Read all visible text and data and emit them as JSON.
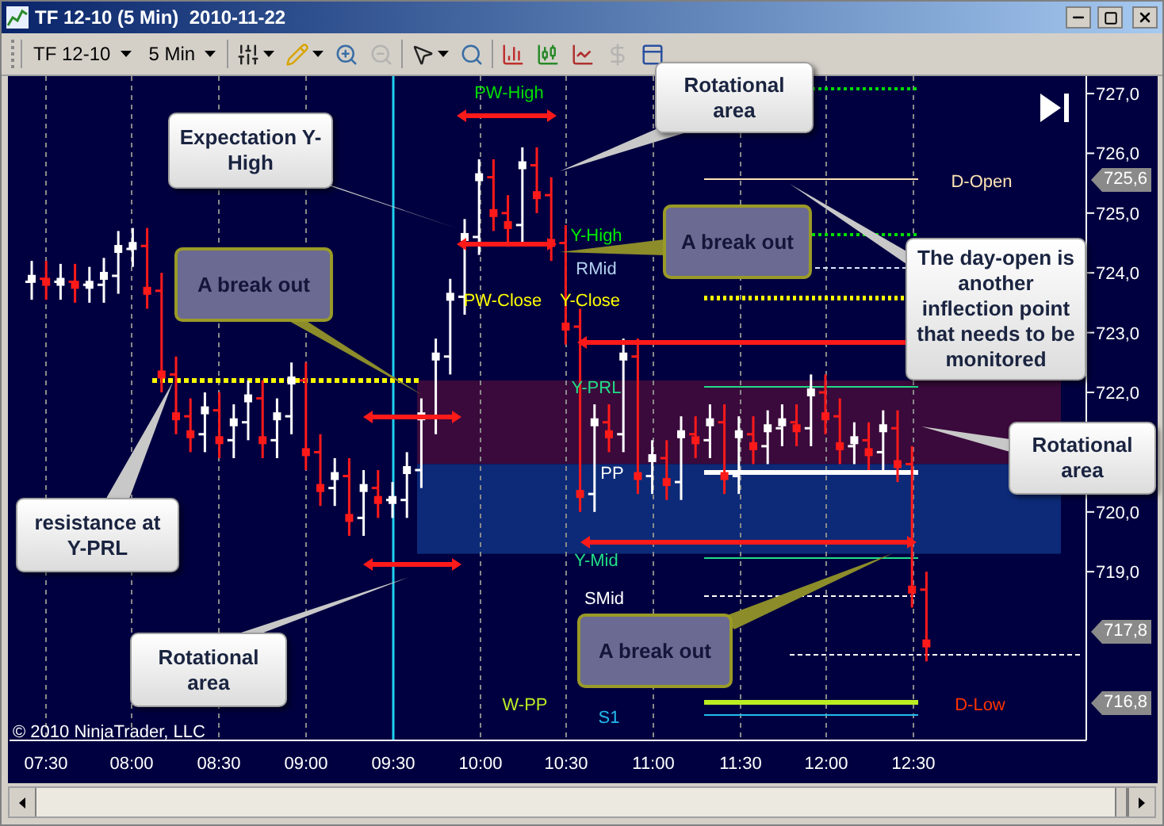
{
  "window": {
    "title": "TF 12-10 (5 Min)  2010-11-22"
  },
  "toolbar": {
    "instrument": "TF 12-10",
    "interval": "5 Min",
    "tools": [
      {
        "kind": "bar-style",
        "disabled": false
      },
      {
        "kind": "draw",
        "disabled": false
      },
      {
        "kind": "zoom-in",
        "disabled": false
      },
      {
        "kind": "zoom-out",
        "disabled": true
      },
      {
        "kind": "select",
        "disabled": false
      },
      {
        "kind": "zoom-box",
        "disabled": false
      },
      {
        "kind": "indicators",
        "disabled": false
      },
      {
        "kind": "chart-style",
        "disabled": false
      },
      {
        "kind": "data-box",
        "disabled": false
      },
      {
        "kind": "currency",
        "disabled": true
      },
      {
        "kind": "properties",
        "disabled": false
      }
    ]
  },
  "chart": {
    "price_axis": [
      "727,0",
      "726,0",
      "725,0",
      "724,0",
      "723,0",
      "722,0",
      "720,0",
      "719,0"
    ],
    "price_tags": [
      "725,6",
      "717,8",
      "716,8"
    ],
    "time_axis": [
      "07:30",
      "08:00",
      "08:30",
      "09:00",
      "09:30",
      "10:00",
      "10:30",
      "11:00",
      "11:30",
      "12:00",
      "12:30"
    ],
    "level_labels": [
      {
        "text": "PW-High",
        "color": "#00dd00"
      },
      {
        "text": "D-Open",
        "color": "#ffe4b4"
      },
      {
        "text": "Y-High",
        "color": "#00ee00"
      },
      {
        "text": "RMid",
        "color": "#b4d2f0"
      },
      {
        "text": "PW-Close",
        "color": "#ffff00"
      },
      {
        "text": "Y-Close",
        "color": "#ffff00"
      },
      {
        "text": "Y-PRL",
        "color": "#22dd88"
      },
      {
        "text": "PP",
        "color": "#ffffff"
      },
      {
        "text": "Y-Mid",
        "color": "#22dd88"
      },
      {
        "text": "SMid",
        "color": "#ffffff"
      },
      {
        "text": "W-PP",
        "color": "#bbee22"
      },
      {
        "text": "S1",
        "color": "#22bbee"
      },
      {
        "text": "D-Low",
        "color": "#ff3300"
      }
    ],
    "callouts": [
      {
        "kind": "note",
        "text": "Rotational area"
      },
      {
        "kind": "note",
        "text": "Expectation Y-High"
      },
      {
        "kind": "breakout",
        "text": "A break out"
      },
      {
        "kind": "breakout",
        "text": "A break out"
      },
      {
        "kind": "note",
        "text": "The day-open is another inflection point that needs to be monitored"
      },
      {
        "kind": "note",
        "text": "Rotational area"
      },
      {
        "kind": "note",
        "text": "resistance at Y-PRL"
      },
      {
        "kind": "breakout",
        "text": "A break out"
      },
      {
        "kind": "note",
        "text": "Rotational area"
      }
    ],
    "copyright": "© 2010 NinjaTrader, LLC"
  }
}
